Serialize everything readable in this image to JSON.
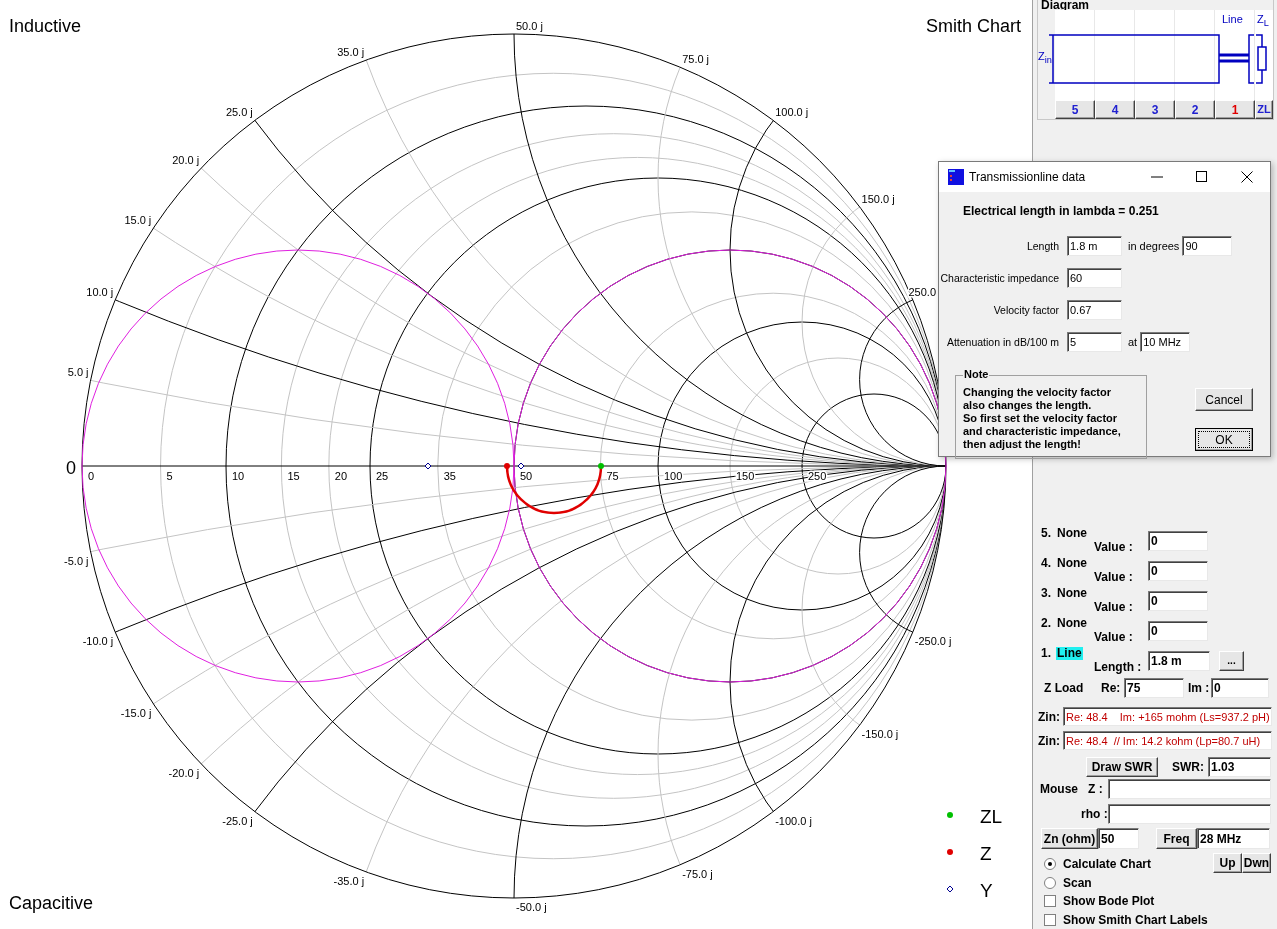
{
  "chart": {
    "title": "Smith Chart",
    "top_label": "Inductive",
    "bottom_label": "Capacitive",
    "origin_label": "0",
    "resistance_labels": [
      "0",
      "5",
      "10",
      "15",
      "20",
      "25",
      "35",
      "50",
      "75",
      "100",
      "150",
      "250"
    ],
    "reactance_labels_positive": [
      "5.0 j",
      "10.0 j",
      "15.0 j",
      "20.0 j",
      "25.0 j",
      "35.0 j",
      "50.0 j",
      "75.0 j",
      "100.0 j",
      "150.0 j",
      "250.0"
    ],
    "reactance_labels_negative": [
      "-5.0 j",
      "-10.0 j",
      "-15.0 j",
      "-20.0 j",
      "-25.0 j",
      "-35.0 j",
      "-50.0 j",
      "-75.0 j",
      "-100.0 j",
      "-150.0 j",
      "-250.0 j"
    ],
    "legend": [
      {
        "label": "ZL",
        "kind": "dot",
        "color": "#00c000"
      },
      {
        "label": "Z",
        "kind": "dot",
        "color": "#e00000"
      },
      {
        "label": "Y",
        "kind": "diamond",
        "color": "#000090"
      }
    ]
  },
  "diagram": {
    "title": "Diagram",
    "zin_label": "Z$_{in}$",
    "line_label": "Line",
    "zl_label": "Z$_{L}$",
    "slots": [
      {
        "label": "5",
        "selected": false
      },
      {
        "label": "4",
        "selected": false
      },
      {
        "label": "3",
        "selected": false
      },
      {
        "label": "2",
        "selected": false
      },
      {
        "label": "1",
        "selected": true
      },
      {
        "label": "ZL",
        "selected": false
      }
    ]
  },
  "components": [
    {
      "number": "5.",
      "name": "None",
      "highlighted": false,
      "value_label": "Value :",
      "value": "0"
    },
    {
      "number": "4.",
      "name": "None",
      "highlighted": false,
      "value_label": "Value :",
      "value": "0"
    },
    {
      "number": "3.",
      "name": "None",
      "highlighted": false,
      "value_label": "Value :",
      "value": "0"
    },
    {
      "number": "2.",
      "name": "None",
      "highlighted": false,
      "value_label": "Value :",
      "value": "0"
    },
    {
      "number": "1.",
      "name": "Line",
      "highlighted": true,
      "value_label": "Length :",
      "value": "1.8 m",
      "button": "..."
    }
  ],
  "load": {
    "label": "Z Load",
    "re_label": "Re:",
    "re": "75",
    "im_label": "Im :",
    "im": "0"
  },
  "zin": [
    {
      "label": "Zin:",
      "value": "Re: 48.4    Im: +165 mohm (Ls=937.2 pH)"
    },
    {
      "label": "Zin:",
      "value": "Re: 48.4  // Im: 14.2 kohm (Lp=80.7 uH)"
    }
  ],
  "swr": {
    "button": "Draw SWR",
    "label": "SWR:",
    "value": "1.03"
  },
  "mouse": {
    "label": "Mouse",
    "z_label": "Z :",
    "rho_label": "rho :"
  },
  "zn": {
    "button": "Zn (ohm)",
    "value": "50"
  },
  "freq": {
    "button": "Freq",
    "value": "28 MHz"
  },
  "step_buttons": [
    "Up",
    "Dwn"
  ],
  "modes": [
    {
      "label": "Calculate Chart",
      "selected": true
    },
    {
      "label": "Scan",
      "selected": false
    }
  ],
  "options": [
    {
      "label": "Show Bode Plot",
      "checked": false
    },
    {
      "label": "Show Smith Chart Labels",
      "checked": false
    }
  ],
  "dialog": {
    "title": "Transmissionline data",
    "heading": "Electrical length in lambda = 0.251",
    "fields": [
      {
        "label": "Length",
        "value": "1.8 m",
        "extra_label": "in degrees",
        "extra_value": "90"
      },
      {
        "label": "Characteristic impedance",
        "value": "60"
      },
      {
        "label": "Velocity factor",
        "value": "0.67"
      },
      {
        "label": "Attenuation in dB/100 m",
        "value": "5",
        "extra_label": "at",
        "extra_value": "10 MHz"
      }
    ],
    "note_title": "Note",
    "note_lines": [
      "Changing the velocity factor",
      "also changes the length.",
      "So first set the velocity factor",
      "and characteristic impedance,",
      "then adjust the length!"
    ],
    "buttons": [
      {
        "label": "Cancel",
        "default": false
      },
      {
        "label": "OK",
        "default": true
      }
    ]
  }
}
